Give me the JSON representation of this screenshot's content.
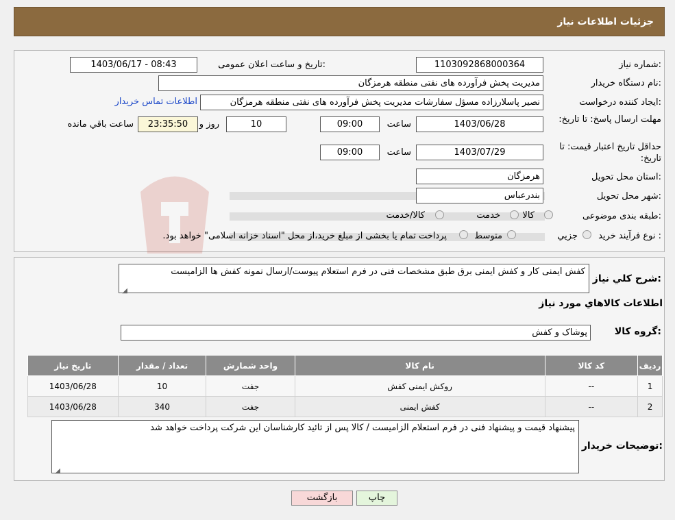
{
  "header": {
    "title": "جزئیات اطلاعات نیاز"
  },
  "form": {
    "need_number": {
      "label": "شماره نیاز:",
      "value": "1103092868000364"
    },
    "announce_datetime": {
      "label": "تاریخ و ساعت اعلان عمومی:",
      "value": "1403/06/17 - 08:43"
    },
    "buyer_org": {
      "label": "نام دستگاه خریدار:",
      "value": "مدیریت پخش فرآورده های نفتی منطقه هرمزگان"
    },
    "requester": {
      "label": "ایجاد کننده درخواست:",
      "value": "نصیر پاسلارزاده مسؤل سفارشات مدیریت پخش فرآورده های نفتی منطقه هرمزگان",
      "contact_link": "اطلاعات تماس خریدار"
    },
    "reply_deadline": {
      "label": "مهلت ارسال پاسخ: تا تاریخ:",
      "date": "1403/06/28",
      "time_label": "ساعت",
      "time": "09:00",
      "days": "10",
      "days_label": "روز و",
      "remaining": "23:35:50",
      "remaining_label": "ساعت باقي مانده"
    },
    "price_validity": {
      "label": "حداقل تاریخ اعتبار قیمت: تا تاریخ:",
      "date": "1403/07/29",
      "time_label": "ساعت",
      "time": "09:00"
    },
    "province": {
      "label": "استان محل تحویل:",
      "value": "هرمزگان"
    },
    "city": {
      "label": "شهر محل تحویل:",
      "value": "بندرعباس"
    },
    "category": {
      "label": "طبقه بندی موضوعی:",
      "options": [
        "کالا",
        "خدمت",
        "کالا/خدمت"
      ]
    },
    "process": {
      "label": "نوع فرآیند خرید :",
      "options": [
        "جزیي",
        "متوسط"
      ],
      "note": "پرداخت تمام یا بخشی از مبلغ خرید،از محل \"اسناد خزانه اسلامی\" خواهد بود."
    }
  },
  "summary": {
    "label": "شرح کلي نياز:",
    "value": "کفش ایمنی کار و کفش ایمنی برق طبق مشخصات فنی در فرم استعلام پیوست/ارسال نمونه کفش ها الزامیست"
  },
  "goods": {
    "section_title": "اطلاعات کالاهاي مورد نياز",
    "group_label": "گروه کالا:",
    "group_value": "پوشاک و کفش",
    "table": {
      "headers": [
        "ردیف",
        "کد کالا",
        "نام کالا",
        "واحد شمارش",
        "تعداد / مقدار",
        "تاریخ نیاز"
      ],
      "rows": [
        [
          "1",
          "--",
          "روکش ایمنی کفش",
          "جفت",
          "10",
          "1403/06/28"
        ],
        [
          "2",
          "--",
          "کفش ایمنی",
          "جفت",
          "340",
          "1403/06/28"
        ]
      ]
    }
  },
  "buyer_notes": {
    "label": "توضیحات خریدار:",
    "value": "پیشنهاد قیمت و پیشنهاد فنی در فرم استعلام الزامیست / کالا پس از تائید کارشناسان این شرکت پرداخت خواهد شد"
  },
  "buttons": {
    "print": "چاپ",
    "back": "بازگشت"
  },
  "colors": {
    "header_bg": "#8b6a3f",
    "table_header_bg": "#8b8b8b",
    "link": "#1a46c8",
    "back_bg": "#f8d8d8",
    "print_bg": "#e4f5dc"
  }
}
